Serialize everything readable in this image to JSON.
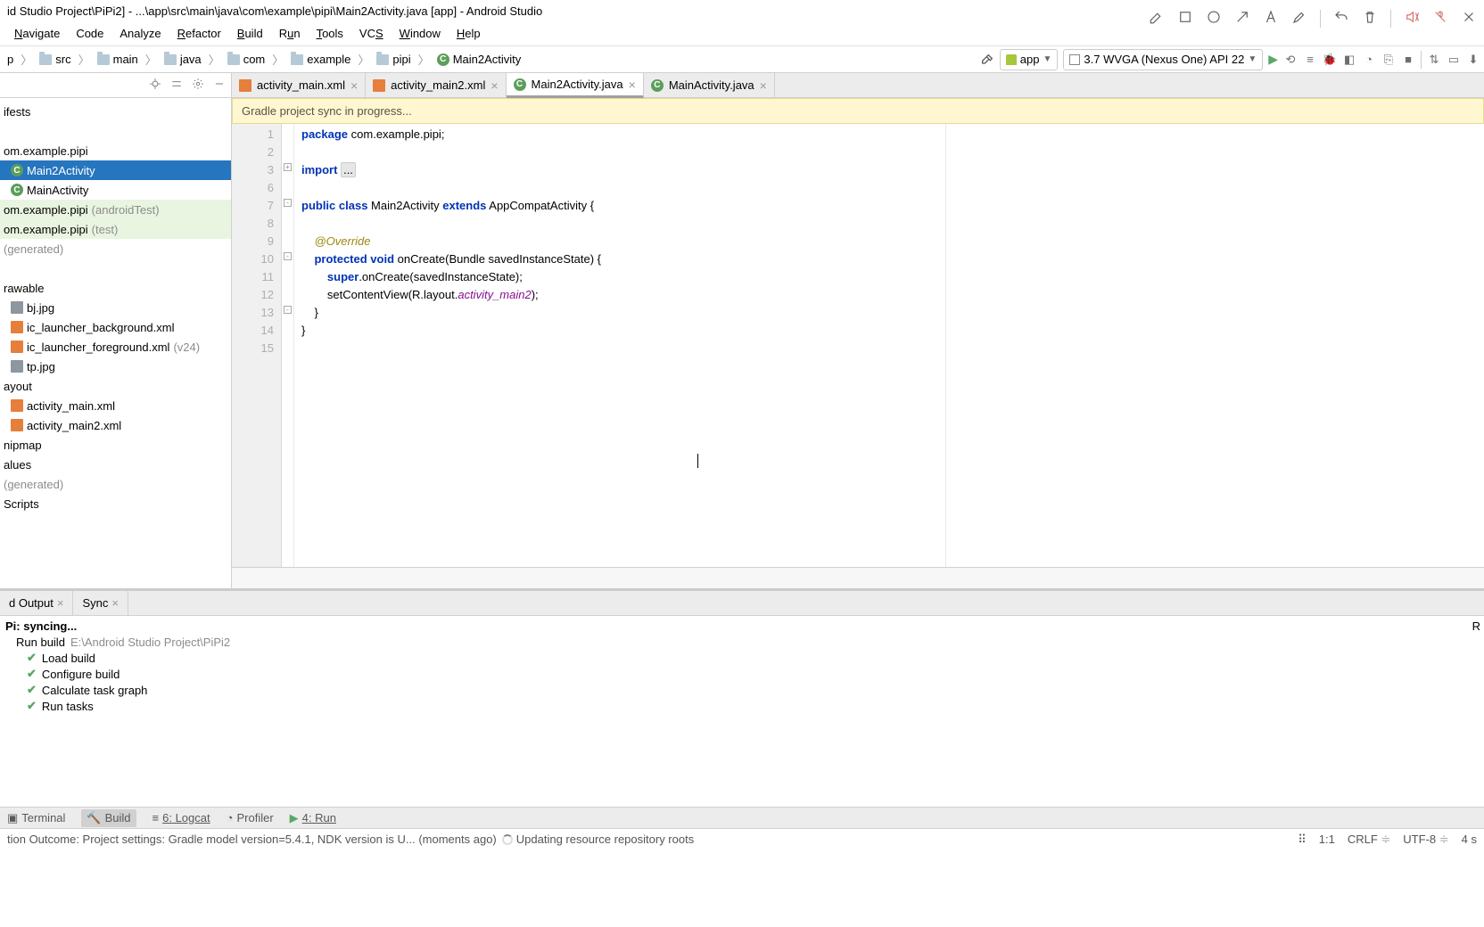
{
  "window": {
    "title": "id Studio Project\\PiPi2] - ...\\app\\src\\main\\java\\com\\example\\pipi\\Main2Activity.java [app] - Android Studio"
  },
  "menu": {
    "navigate": "Navigate",
    "code": "Code",
    "analyze": "Analyze",
    "refactor": "Refactor",
    "build": "Build",
    "run": "Run",
    "tools": "Tools",
    "vcs": "VCS",
    "window": "Window",
    "help": "Help"
  },
  "breadcrumbs": [
    "p",
    "src",
    "main",
    "java",
    "com",
    "example",
    "pipi",
    "Main2Activity"
  ],
  "run_config": {
    "module": "app",
    "device": "3.7  WVGA (Nexus One) API 22"
  },
  "project_tree": {
    "manifests": "ifests",
    "pkg": "om.example.pipi",
    "main2": "Main2Activity",
    "main": "MainActivity",
    "pkg_at": "om.example.pipi",
    "pkg_at_suffix": "(androidTest)",
    "pkg_test": "om.example.pipi",
    "pkg_test_suffix": "(test)",
    "gen1": "(generated)",
    "drawable": "rawable",
    "bj": "bj.jpg",
    "ic_bg": "ic_launcher_background.xml",
    "ic_fg": "ic_launcher_foreground.xml",
    "ic_fg_suffix": "(v24)",
    "tp": "tp.jpg",
    "layout": "ayout",
    "am": "activity_main.xml",
    "am2": "activity_main2.xml",
    "mipmap": "nipmap",
    "values": "alues",
    "gen2": "(generated)",
    "scripts": "Scripts"
  },
  "tabs": {
    "t1": "activity_main.xml",
    "t2": "activity_main2.xml",
    "t3": "Main2Activity.java",
    "t4": "MainActivity.java"
  },
  "banner": "Gradle project sync in progress...",
  "code": {
    "l1_kw": "package",
    "l1_rest": " com.example.pipi;",
    "l3_kw": "import",
    "l3_fold": "...",
    "l7a": "public class",
    "l7b": " Main2Activity ",
    "l7c": "extends",
    "l7d": " AppCompatActivity {",
    "l9": "@Override",
    "l10a": "protected void",
    "l10b": " onCreate(Bundle savedInstanceState) {",
    "l11a": "super",
    "l11b": ".onCreate(savedInstanceState);",
    "l12a": "        setContentView(R.layout.",
    "l12b": "activity_main2",
    "l12c": ");",
    "l13": "    }",
    "l14": "}",
    "line_numbers": [
      "1",
      "2",
      "3",
      "6",
      "7",
      "8",
      "9",
      "10",
      "11",
      "12",
      "13",
      "14",
      "15"
    ]
  },
  "bottom_tabs": {
    "output": "d Output",
    "sync": "Sync"
  },
  "build": {
    "syncing": "Pi: syncing...",
    "runbuild": "Run build",
    "runbuild_path": "E:\\Android Studio Project\\PiPi2",
    "load": "Load build",
    "configure": "Configure build",
    "taskgraph": "Calculate task graph",
    "runtasks": "Run tasks",
    "r_label": "R"
  },
  "toolwindows": {
    "terminal": "Terminal",
    "build": "Build",
    "logcat": "6: Logcat",
    "profiler": "Profiler",
    "run": "4: Run"
  },
  "status": {
    "left1": "tion Outcome: Project settings: Gradle model version=5.4.1, NDK version is U... (moments ago)",
    "left2": "Updating resource repository roots",
    "pos": "1:1",
    "crlf": "CRLF",
    "enc": "UTF-8",
    "spaces": "4 s"
  }
}
